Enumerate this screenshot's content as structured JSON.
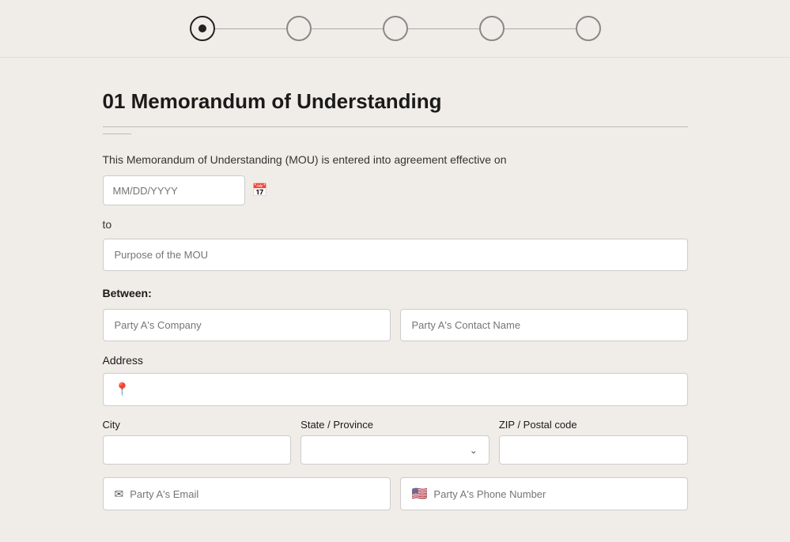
{
  "progress": {
    "steps": [
      {
        "id": "step-1",
        "active": true
      },
      {
        "id": "step-2",
        "active": false
      },
      {
        "id": "step-3",
        "active": false
      },
      {
        "id": "step-4",
        "active": false
      },
      {
        "id": "step-5",
        "active": false
      }
    ]
  },
  "page": {
    "title": "01 Memorandum of Understanding",
    "intro_text": "This Memorandum of Understanding (MOU) is entered into agreement effective on",
    "date_placeholder": "MM/DD/YYYY",
    "to_label": "to",
    "purpose_placeholder": "Purpose of the MOU",
    "between_label": "Between:",
    "party_a_company_placeholder": "Party A's Company",
    "party_a_contact_placeholder": "Party A's Contact Name",
    "address_label": "Address",
    "city_label": "City",
    "state_label": "State / Province",
    "zip_label": "ZIP / Postal code",
    "email_placeholder": "Party A's Email",
    "phone_placeholder": "Party A's Phone Number"
  }
}
